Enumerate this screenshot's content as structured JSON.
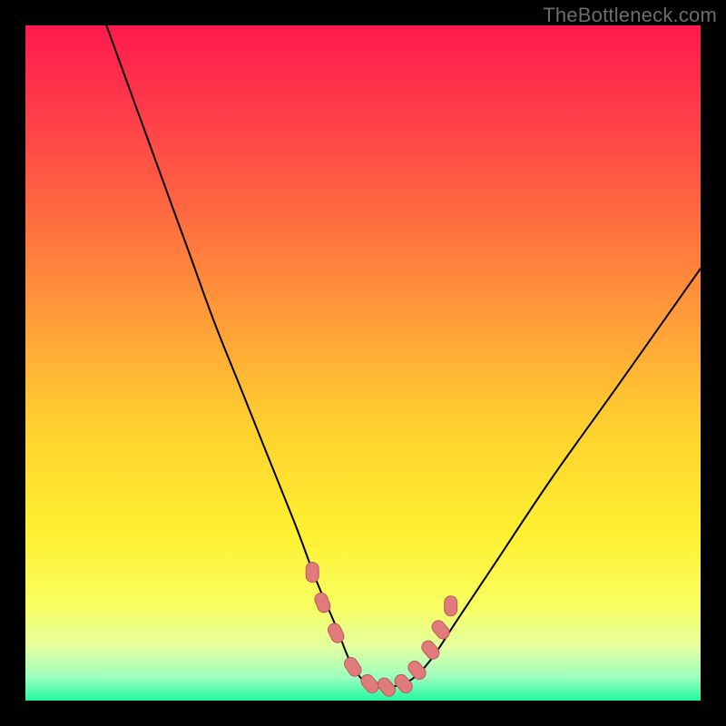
{
  "watermark": "TheBottleneck.com",
  "colors": {
    "frame": "#000000",
    "curve_stroke": "#000000",
    "marker_fill": "#e17a7a",
    "marker_stroke": "#bb5a5a",
    "gradient_stops": [
      {
        "offset": 0.0,
        "color": "#ff1a4d"
      },
      {
        "offset": 0.12,
        "color": "#ff3a4a"
      },
      {
        "offset": 0.28,
        "color": "#ff6a40"
      },
      {
        "offset": 0.45,
        "color": "#ffa238"
      },
      {
        "offset": 0.6,
        "color": "#ffd22e"
      },
      {
        "offset": 0.75,
        "color": "#fff030"
      },
      {
        "offset": 0.86,
        "color": "#f8ff60"
      },
      {
        "offset": 0.92,
        "color": "#e4ffa0"
      },
      {
        "offset": 0.965,
        "color": "#9dffc0"
      },
      {
        "offset": 1.0,
        "color": "#22f7a0"
      }
    ]
  },
  "chart_data": {
    "type": "line",
    "title": "",
    "xlabel": "",
    "ylabel": "",
    "xlim": [
      0,
      100
    ],
    "ylim": [
      0,
      100
    ],
    "grid": false,
    "legend": false,
    "series": [
      {
        "name": "bottleneck-curve",
        "x": [
          12,
          16,
          20,
          24,
          28,
          32,
          36,
          40,
          43,
          46,
          48,
          50,
          52,
          54,
          57,
          60,
          64,
          70,
          78,
          88,
          100
        ],
        "y": [
          100,
          89,
          78,
          67,
          56,
          46,
          36,
          26,
          18,
          11,
          6,
          3,
          2,
          2,
          3,
          6,
          12,
          21,
          33,
          47,
          64
        ]
      }
    ],
    "markers": {
      "name": "highlight-points",
      "x": [
        42.5,
        44.0,
        46.0,
        48.5,
        51.0,
        53.5,
        56.0,
        58.0,
        60.0,
        61.5,
        63.0
      ],
      "y": [
        19.0,
        14.5,
        10.0,
        5.0,
        2.5,
        2.0,
        2.5,
        4.5,
        7.5,
        10.5,
        14.0
      ]
    }
  }
}
